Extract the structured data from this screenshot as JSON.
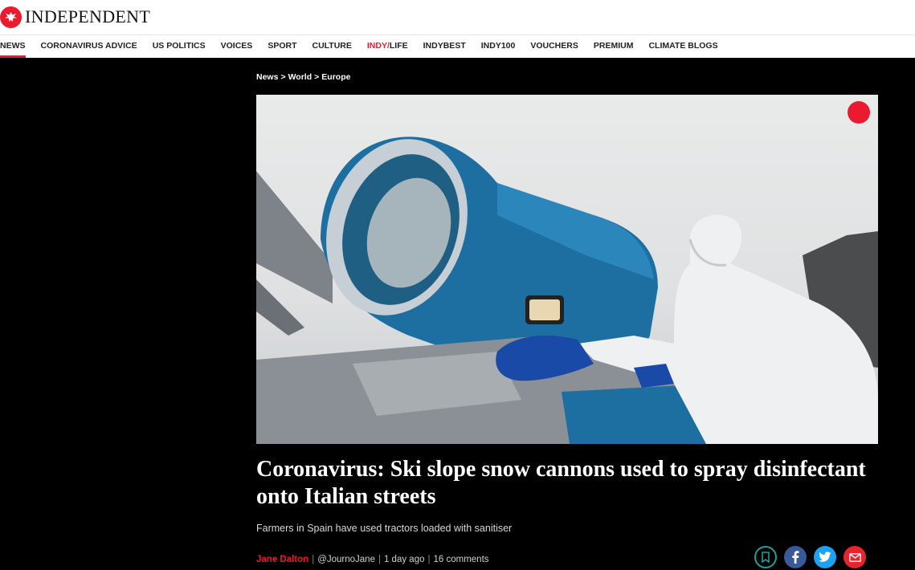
{
  "header": {
    "brand_name": "INDEPENDENT",
    "brand_color": "#ec1a2e",
    "logo_icon": "eagle-logo-icon"
  },
  "nav": {
    "items": [
      {
        "label": "NEWS",
        "active": true
      },
      {
        "label": "CORONAVIRUS ADVICE"
      },
      {
        "label": "US POLITICS"
      },
      {
        "label": "VOICES"
      },
      {
        "label": "SPORT"
      },
      {
        "label": "CULTURE"
      },
      {
        "label_prefix": "INDY",
        "label_slash": "/",
        "label_suffix": "LIFE"
      },
      {
        "label": "INDYBEST"
      },
      {
        "label": "INDY100"
      },
      {
        "label": "VOUCHERS"
      },
      {
        "label": "PREMIUM"
      },
      {
        "label": "CLIMATE BLOGS"
      }
    ]
  },
  "breadcrumb": {
    "items": [
      "News",
      "World",
      "Europe"
    ],
    "separator": ">"
  },
  "article": {
    "headline": "Coronavirus: Ski slope snow cannons used to spray disinfectant onto Italian streets",
    "standfirst": "Farmers in Spain have used tractors loaded with sanitiser",
    "author": "Jane Dalton",
    "handle": "@JournoJane",
    "published": "1 day ago",
    "comments": "16 comments"
  },
  "share": {
    "icons": [
      "bookmark-icon",
      "facebook-icon",
      "twitter-icon",
      "email-icon"
    ],
    "colors": {
      "bookmark": "#1e9e9a",
      "facebook": "#3b5998",
      "twitter": "#1da1f2",
      "email": "#e6262e"
    }
  }
}
